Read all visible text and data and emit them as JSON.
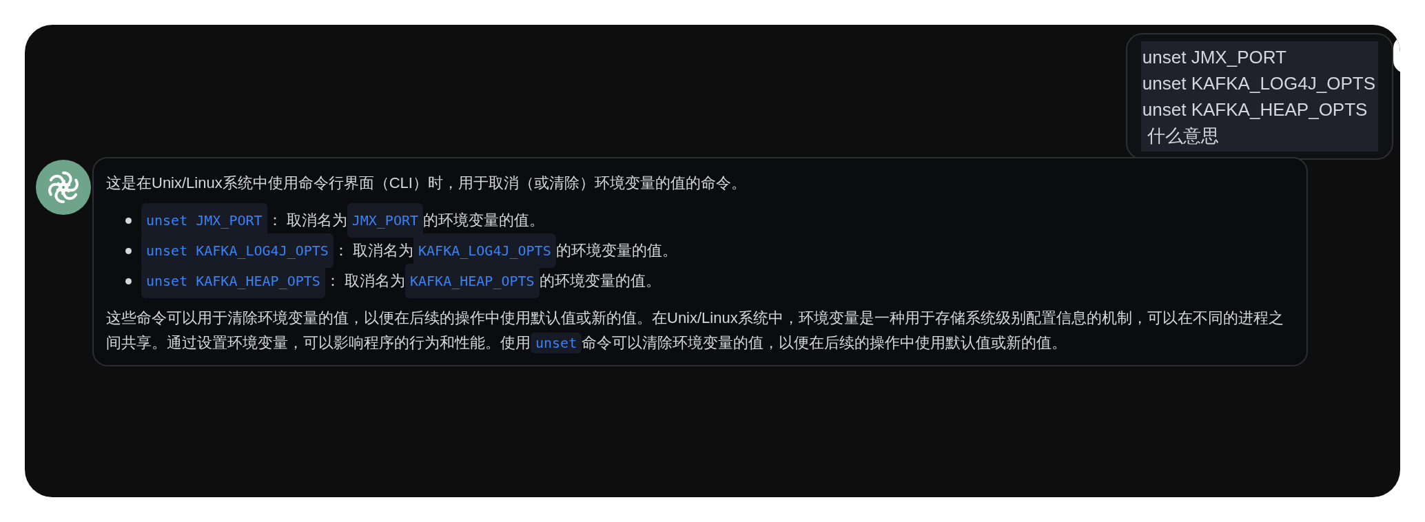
{
  "user_message": {
    "lines": [
      "unset JMX_PORT",
      "unset KAFKA_LOG4J_OPTS",
      "unset KAFKA_HEAP_OPTS",
      " 什么意思"
    ]
  },
  "assistant_message": {
    "intro": "这是在Unix/Linux系统中使用命令行界面（CLI）时，用于取消（或清除）环境变量的值的命令。",
    "bullets": [
      [
        {
          "kind": "code",
          "text": "unset JMX_PORT"
        },
        {
          "kind": "text",
          "text": "： 取消名为"
        },
        {
          "kind": "code",
          "text": "JMX_PORT"
        },
        {
          "kind": "text",
          "text": "的环境变量的值。"
        }
      ],
      [
        {
          "kind": "code",
          "text": "unset KAFKA_LOG4J_OPTS"
        },
        {
          "kind": "text",
          "text": "： 取消名为"
        },
        {
          "kind": "code",
          "text": "KAFKA_LOG4J_OPTS"
        },
        {
          "kind": "text",
          "text": "的环境变量的值。"
        }
      ],
      [
        {
          "kind": "code",
          "text": "unset KAFKA_HEAP_OPTS"
        },
        {
          "kind": "text",
          "text": "： 取消名为"
        },
        {
          "kind": "code",
          "text": "KAFKA_HEAP_OPTS"
        },
        {
          "kind": "text",
          "text": "的环境变量的值。"
        }
      ]
    ],
    "paragraph": [
      {
        "kind": "text",
        "text": "这些命令可以用于清除环境变量的值，以便在后续的操作中使用默认值或新的值。在Unix/Linux系统中，环境变量是一种用于存储系统级别配置信息的机制，可以在不同的进程之间共享。通过设置环境变量，可以影响程序的行为和性能。使用"
      },
      {
        "kind": "code",
        "text": "unset"
      },
      {
        "kind": "text",
        "text": "命令可以清除环境变量的值，以便在后续的操作中使用默认值或新的值。"
      }
    ]
  }
}
